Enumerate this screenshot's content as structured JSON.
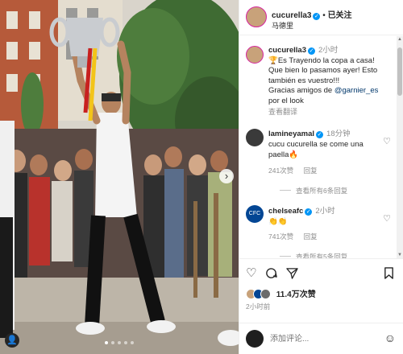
{
  "post": {
    "username": "cucurella3",
    "dot": "•",
    "follow_status": "已关注",
    "location": "马德里"
  },
  "caption": {
    "username": "cucurella3",
    "time": "2小时",
    "text_1": "🏆Es Trayendo la copa a casa!",
    "text_2": "Que bien lo pasamos ayer! Esto también es vuestro!!!",
    "text_3": "Gracias amigos de ",
    "mention": "@garnier_es",
    "text_4": " por el look",
    "translate": "查看翻译"
  },
  "comments": [
    {
      "username": "lamineyamal",
      "time": "18分钟",
      "text": "cucu cucurella se come una paella🔥",
      "likes": "241次赞",
      "reply": "回复",
      "more": "查看所有6条回复"
    },
    {
      "username": "chelseafc",
      "time": "2小时",
      "text": "👏👏",
      "likes": "741次赞",
      "reply": "回复",
      "more": "查看所有5条回复"
    }
  ],
  "actions": {
    "likes": "11.4万次赞",
    "time": "2小时前"
  },
  "add_comment": {
    "placeholder": "添加评论..."
  },
  "icons": {
    "like": "heart-icon",
    "comment": "comment-icon",
    "share": "share-icon",
    "save": "bookmark-icon",
    "emoji": "emoji-icon",
    "verified": "verified-badge-icon"
  },
  "colors": {
    "verified": "#0095f6",
    "link": "#00376b",
    "secondary_text": "#8e8e8e"
  }
}
